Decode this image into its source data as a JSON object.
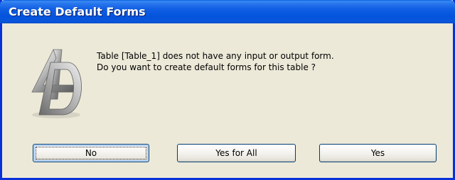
{
  "window": {
    "title": "Create Default Forms"
  },
  "logo": {
    "icon": "4d-logo-icon"
  },
  "message": {
    "line1": "Table [Table_1] does not have any input or output form.",
    "line2": "Do you want to create default forms for this table ?"
  },
  "buttons": {
    "no_label": "No",
    "yes_for_all_label": "Yes for All",
    "yes_label": "Yes"
  },
  "colors": {
    "titlebar": "#0453dc",
    "window_border": "#0831d9",
    "dialog_background": "#ece9d8"
  }
}
